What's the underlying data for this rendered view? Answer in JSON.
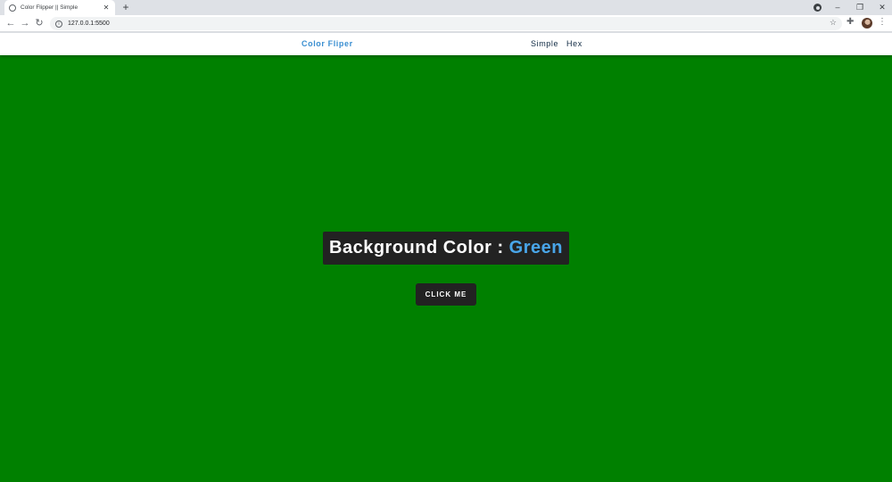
{
  "browser": {
    "tab_title": "Color Flipper || Simple",
    "tab_close": "✕",
    "new_tab": "+",
    "url": "127.0.0.1:5500",
    "window_buttons": {
      "minimize": "–",
      "restore": "❐",
      "close": "✕"
    }
  },
  "navbar": {
    "brand": "Color Fliper",
    "links": [
      "Simple",
      "Hex"
    ]
  },
  "main": {
    "label": "Background Color :",
    "color_name": "Green",
    "button_label": "CLICK ME"
  },
  "colors": {
    "page_background": "#008000",
    "accent": "#49a6e9",
    "box_background": "#222222"
  }
}
